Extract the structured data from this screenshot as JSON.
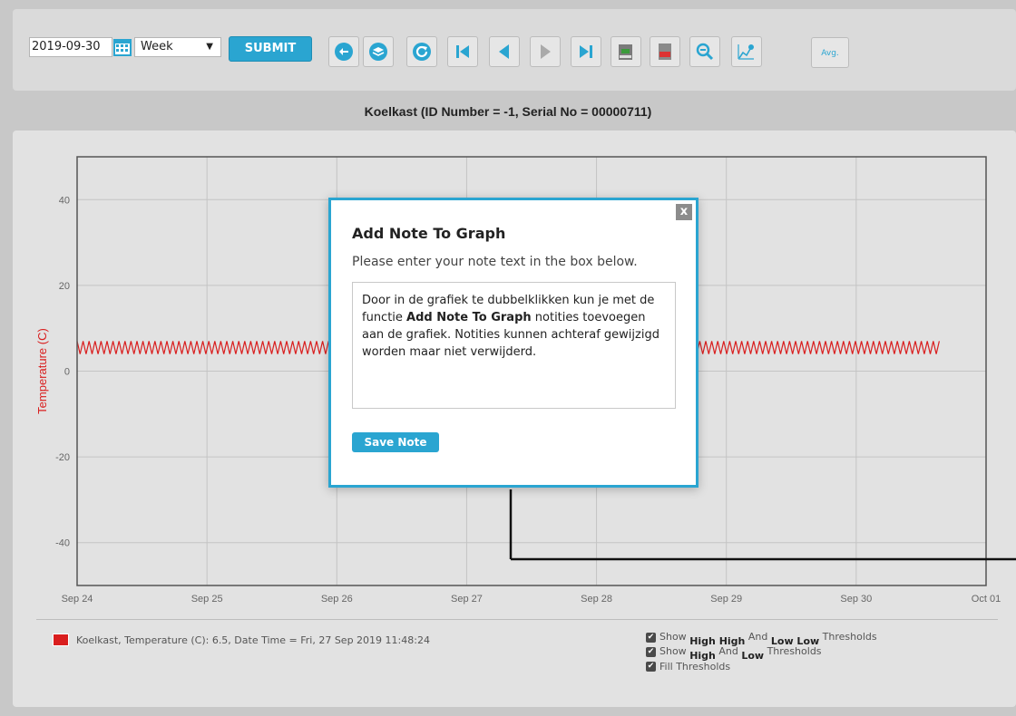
{
  "toolbar": {
    "date_value": "2019-09-30",
    "period_value": "Week",
    "submit_label": "SUBMIT",
    "avg_label": "Avg.",
    "icons": [
      "back-icon",
      "layers-icon",
      "refresh-icon",
      "first-icon",
      "previous-icon",
      "play-icon",
      "last-icon",
      "export-csv-icon",
      "export-pdf-icon",
      "zoom-icon",
      "chart-settings-icon"
    ]
  },
  "chart_title": "Koelkast (ID Number = -1, Serial No = 00000711)",
  "chart_data": {
    "type": "line",
    "ylabel": "Temperature (C)",
    "xlabel": "",
    "ylim": [
      -50,
      50
    ],
    "yticks": [
      40,
      20,
      0,
      -20,
      -40
    ],
    "xticks": [
      "Sep 24",
      "Sep 25",
      "Sep 26",
      "Sep 27",
      "Sep 28",
      "Sep 29",
      "Sep 30",
      "Oct 01"
    ],
    "series": [
      {
        "name": "Koelkast, Temperature (C)",
        "color": "#d91e1e",
        "x_start": "Sep 24",
        "x_end": "Sep 30",
        "pattern": "oscillating",
        "min": 4,
        "max": 7
      }
    ]
  },
  "legend": {
    "text": "Koelkast, Temperature (C): 6.5, Date Time = Fri, 27 Sep 2019 11:48:24",
    "swatch_color": "#d91e1e"
  },
  "checkboxes": [
    {
      "pre": "Show ",
      "b1": "High High",
      "mid": " And ",
      "b2": "Low Low",
      "post": " Thresholds"
    },
    {
      "pre": "Show ",
      "b1": "High",
      "mid": " And ",
      "b2": "Low",
      "post": " Thresholds"
    },
    {
      "pre": "Fill Thresholds",
      "b1": "",
      "mid": "",
      "b2": "",
      "post": ""
    }
  ],
  "modal": {
    "title": "Add Note To Graph",
    "subtitle": "Please enter your note text in the box below.",
    "note_part1": "Door in de grafiek te dubbelklikken kun je met de functie ",
    "note_bold": "Add Note To Graph",
    "note_part2": " notities toevoegen aan de grafiek. Notities kunnen achteraf gewijzigd worden maar niet verwijderd.",
    "save_label": "Save Note",
    "close_label": "x"
  }
}
